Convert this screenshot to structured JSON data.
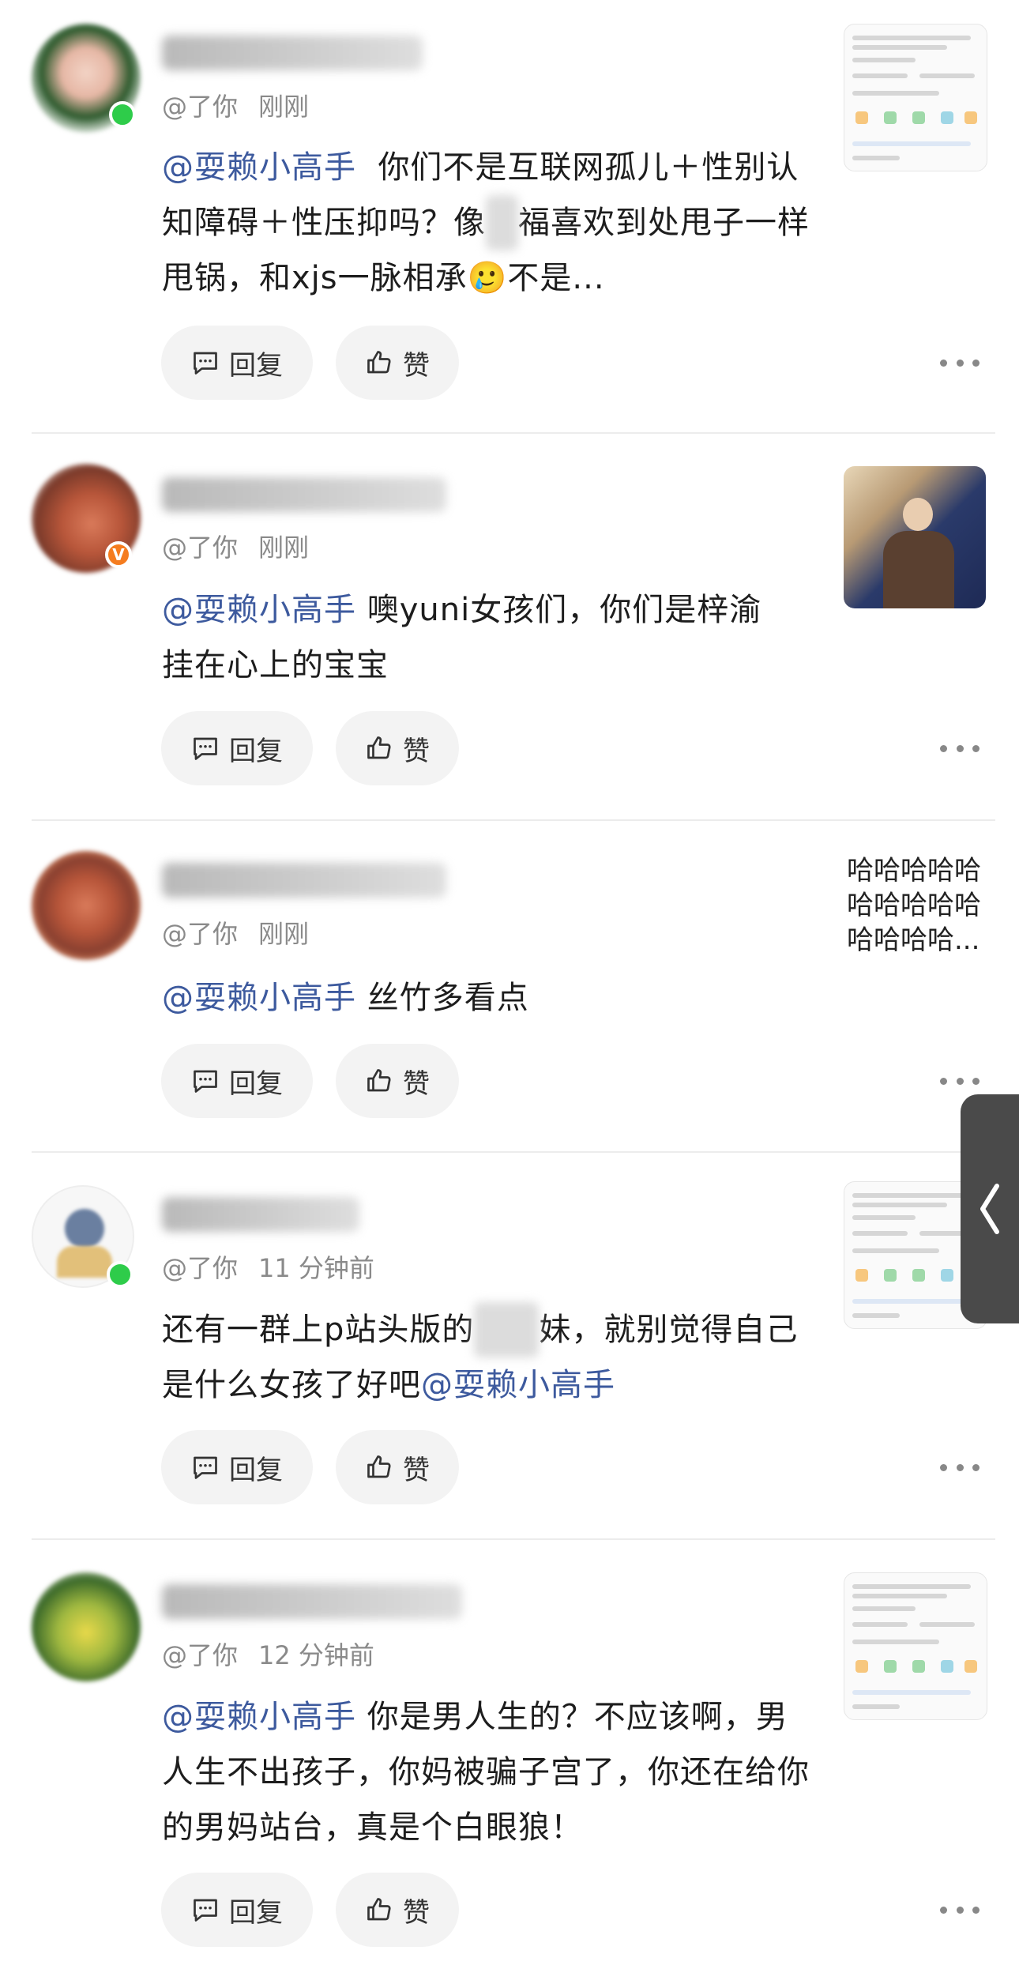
{
  "buttons": {
    "reply": "回复",
    "like": "赞"
  },
  "comments": [
    {
      "handle": "@了你",
      "time": "刚刚",
      "mention": "@耍赖小高手",
      "text_a": "你们不是互联网孤儿＋性别认知障碍＋性压抑吗？像",
      "text_blur": "小",
      "text_b": "福喜欢到处甩子一样甩锅，和xjs一脉相承🥲不是..."
    },
    {
      "handle": "@了你",
      "time": "刚刚",
      "mention": "@耍赖小高手",
      "text": " 噢yuni女孩们，你们是梓渝挂在心上的宝宝"
    },
    {
      "handle": "@了你",
      "time": "刚刚",
      "mention": "@耍赖小高手",
      "text": " 丝竹多看点",
      "side_text": "哈哈哈哈哈哈哈哈哈哈哈哈哈哈..."
    },
    {
      "handle": "@了你",
      "time": "11 分钟前",
      "text_a": "还有一群上p站头版的",
      "text_blur": "妹妹",
      "text_b": "妹，就别觉得自己是什么女孩了好吧",
      "mention": "@耍赖小高手"
    },
    {
      "handle": "@了你",
      "time": "12 分钟前",
      "mention": "@耍赖小高手",
      "text": " 你是男人生的？不应该啊，男人生不出孩子，你妈被骗子宫了，你还在给你的男妈站台，真是个白眼狼！"
    }
  ],
  "colors": {
    "mention": "#3d5a9e",
    "meta": "#8a8a8a",
    "button_bg": "#f3f3f3",
    "online_badge": "#2ecc4a"
  },
  "icons": [
    "comment-icon",
    "thumbs-up-icon",
    "more-icon",
    "chevron-left-icon"
  ]
}
